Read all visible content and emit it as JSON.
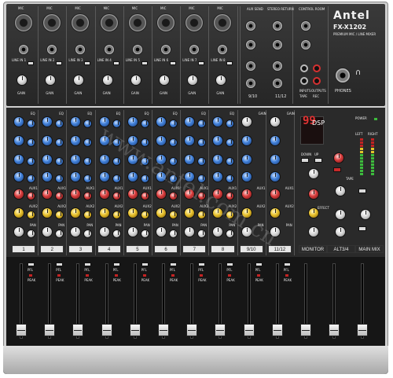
{
  "brand": {
    "name": "Antel",
    "model": "FX-X1202",
    "subtitle": "PREMIUM MIC / LINE MIXER"
  },
  "channels": {
    "mic_label": "MIC",
    "line_labels": [
      "LINE IN 1",
      "LINE IN 2",
      "LINE IN 3",
      "LINE IN 4",
      "LINE IN 5",
      "LINE IN 6",
      "LINE IN 7",
      "LINE IN 8"
    ],
    "gain_label": "GAIN",
    "eq_label": "EQ",
    "aux1_label": "AUX1",
    "aux2_label": "AUX2",
    "pan_label": "PAN",
    "numbers": [
      "1",
      "2",
      "3",
      "4",
      "5",
      "6",
      "7",
      "8",
      "9/10",
      "11/12"
    ],
    "pfl_label": "PFL",
    "peak_label": "PEAK"
  },
  "rear_panel": {
    "aux_send": "AUX SEND",
    "stereo_return": "STEREO RETURN",
    "control_room": "CONTROL ROOM",
    "st_in_1": "9/10",
    "st_in_2": "11/12",
    "input": "INPUTS",
    "output": "OUTPUTS",
    "tape": "TAPE",
    "rec": "REC",
    "phones": "PHONES"
  },
  "dsp": {
    "label": "DSP",
    "display": "99",
    "down": "DOWN",
    "up": "UP",
    "power": "POWER",
    "left": "LEFT",
    "right": "RIGHT",
    "tape": "TAPE",
    "effect": "EFFECT"
  },
  "buses": {
    "monitor": "MONITOR",
    "alt": "ALT3/4",
    "main": "MAIN MIX"
  },
  "watermark": "www.antel.com.cn",
  "colors": {
    "body": "#2a2a2a",
    "lower_body": "#1a1a1a",
    "silver": "#c8c8c8",
    "knob_blue": "#3f7fd8",
    "knob_red": "#d83b3b",
    "knob_yellow": "#e7c02a"
  }
}
